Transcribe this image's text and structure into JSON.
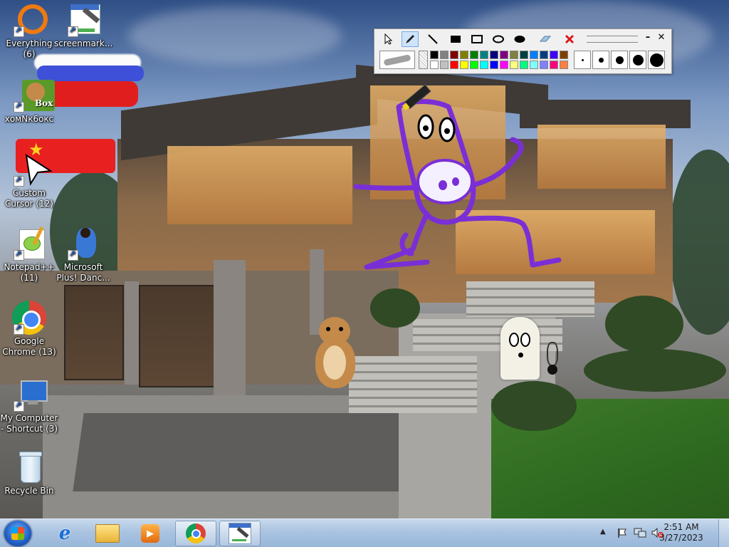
{
  "desktop": {
    "icons": [
      {
        "name": "everything-shortcut",
        "label": "Everything (6)",
        "icon": "everything-icon"
      },
      {
        "name": "screenmarker-shortcut",
        "label": "screenmark...",
        "icon": "screenmarker-icon"
      },
      {
        "name": "homnk-box-shortcut",
        "label": "хомNк6окс",
        "icon": "hamster-box-icon",
        "icon_text": "Box"
      },
      {
        "name": "custom-cursor-shortcut",
        "label": "Custom Cursor (12)",
        "icon": "cursor-arrow-icon"
      },
      {
        "name": "notepadpp-shortcut",
        "label": "Notepad++ (11)",
        "icon": "notepadpp-icon"
      },
      {
        "name": "microsoft-plus-dance-shortcut",
        "label": "Microsoft Plus! Danc...",
        "icon": "dancer-icon"
      },
      {
        "name": "google-chrome-shortcut",
        "label": "Google Chrome (13)",
        "icon": "chrome-icon"
      },
      {
        "name": "my-computer-shortcut",
        "label": "My Computer - Shortcut (3)",
        "icon": "computer-icon"
      },
      {
        "name": "recycle-bin",
        "label": "Recycle Bin",
        "icon": "recycle-bin-icon"
      }
    ]
  },
  "screenmarker_toolbar": {
    "tools": [
      "select-arrow",
      "marker-pen",
      "line",
      "filled-rectangle",
      "rectangle",
      "ellipse",
      "filled-ellipse",
      "eraser",
      "clear-all"
    ],
    "active_tool": "marker-pen",
    "palette_row1": [
      "#000000",
      "#808080",
      "#800000",
      "#808000",
      "#008000",
      "#008080",
      "#000080",
      "#800080",
      "#808040",
      "#004040",
      "#0080ff",
      "#004080",
      "#4000ff",
      "#804000"
    ],
    "palette_row2": [
      "#ffffff",
      "#c0c0c0",
      "#ff0000",
      "#ffff00",
      "#00ff00",
      "#00ffff",
      "#0000ff",
      "#ff00ff",
      "#ffff80",
      "#00ff80",
      "#80ffff",
      "#8080ff",
      "#ff0080",
      "#ff8040"
    ],
    "brush_sizes": [
      "tiny",
      "small",
      "medium",
      "large",
      "extra-large"
    ],
    "minimize_symbol": "–",
    "close_symbol": "✕"
  },
  "taskbar": {
    "start": "start-orb",
    "pinned": [
      {
        "name": "internet-explorer",
        "icon": "ie-icon",
        "open": false
      },
      {
        "name": "windows-explorer",
        "icon": "folder-icon",
        "open": false
      },
      {
        "name": "media-player",
        "icon": "media-player-icon",
        "open": false
      },
      {
        "name": "chrome",
        "icon": "chrome-icon",
        "open": true
      },
      {
        "name": "screenmarker",
        "icon": "screenmarker-icon",
        "open": true
      }
    ],
    "clock": {
      "time": "2:51 AM",
      "date": "3/27/2023"
    }
  },
  "colors": {
    "drawing_purple": "#7a2fd6",
    "taskbar": "#a9c3e0",
    "active_tool_bg": "#cfe3fb"
  }
}
